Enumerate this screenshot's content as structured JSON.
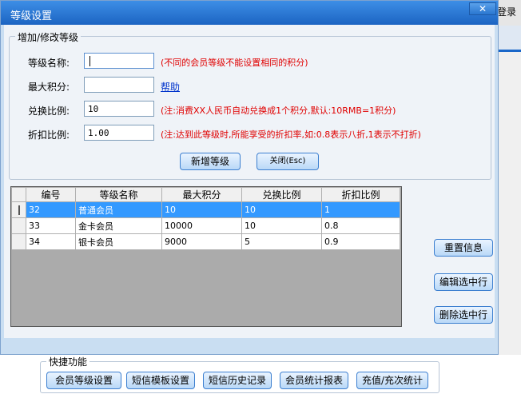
{
  "background": {
    "login_label": "登录"
  },
  "dialog": {
    "title": "等级设置",
    "close_glyph": "✕",
    "group_title": "增加/修改等级",
    "fields": {
      "name": {
        "label": "等级名称:",
        "value": "",
        "note": "(不同的会员等级不能设置相同的积分)"
      },
      "max_points": {
        "label": "最大积分:",
        "value": "",
        "help": "帮助"
      },
      "ratio": {
        "label": "兑换比例:",
        "value": "10",
        "note": "(注:消费XX人民币自动兑换成1个积分,默认:10RMB=1积分)"
      },
      "discount": {
        "label": "折扣比例:",
        "value": "1.00",
        "note": "(注:达到此等级时,所能享受的折扣率,如:0.8表示八折,1表示不打折)"
      }
    },
    "buttons": {
      "add": "新增等级",
      "close": "关闭(Esc)",
      "reset": "重置信息",
      "edit": "编辑选中行",
      "delete": "删除选中行"
    },
    "table": {
      "columns": [
        "编号",
        "等级名称",
        "最大积分",
        "兑换比例",
        "折扣比例"
      ],
      "rows": [
        [
          "32",
          "普通会员",
          "10",
          "10",
          "1"
        ],
        [
          "33",
          "金卡会员",
          "10000",
          "10",
          "0.8"
        ],
        [
          "34",
          "银卡会员",
          "9000",
          "5",
          "0.9"
        ]
      ],
      "selected_row": 0
    }
  },
  "quick": {
    "title": "快捷功能",
    "buttons": [
      "会员等级设置",
      "短信模板设置",
      "短信历史记录",
      "会员统计报表",
      "充值/充次统计"
    ]
  },
  "colors": {
    "titlebar": "#1c64c2",
    "selection": "#3399ff",
    "note_red": "#e00000",
    "link": "#0033cc"
  }
}
